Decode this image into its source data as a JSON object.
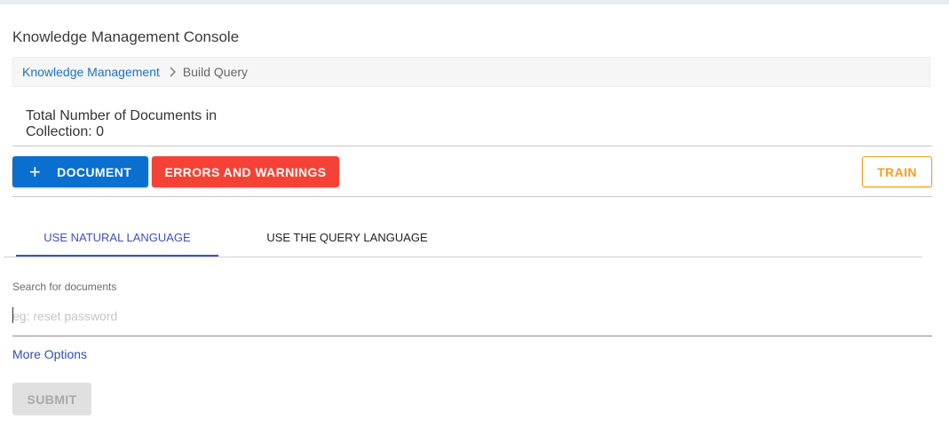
{
  "header": {
    "title": "Knowledge Management Console"
  },
  "breadcrumb": {
    "items": [
      {
        "label": "Knowledge Management"
      },
      {
        "label": "Build Query"
      }
    ]
  },
  "collection": {
    "count_text": "Total Number of Documents in Collection: 0"
  },
  "toolbar": {
    "add_document_label": "DOCUMENT",
    "errors_label": "ERRORS AND WARNINGS",
    "train_label": "TRAIN"
  },
  "tabs": [
    {
      "label": "USE NATURAL LANGUAGE",
      "active": true
    },
    {
      "label": "USE THE QUERY LANGUAGE",
      "active": false
    }
  ],
  "search": {
    "label": "Search for documents",
    "placeholder": "eg: reset password",
    "value": ""
  },
  "more_options_label": "More Options",
  "submit_label": "SUBMIT",
  "colors": {
    "primary": "#0a6fce",
    "error": "#f44336",
    "warning": "#f0a020",
    "tab_active": "#3f51b5"
  },
  "icons": {
    "add": "plus-icon",
    "breadcrumb_separator": "chevron-right-icon"
  }
}
